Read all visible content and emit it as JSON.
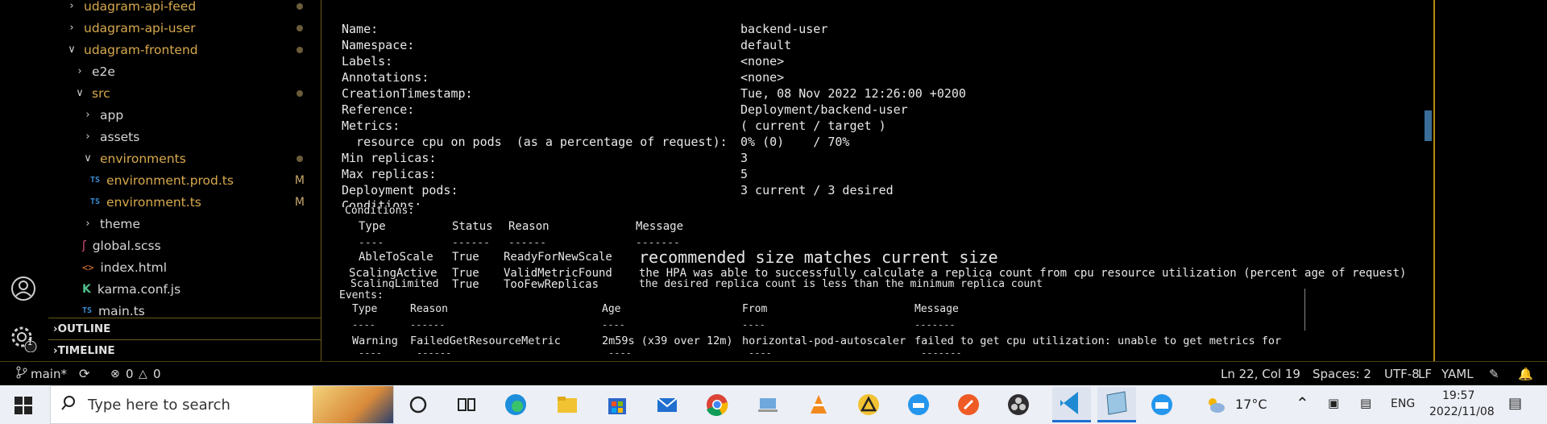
{
  "explorer": {
    "items": [
      {
        "label": "udagram-api-feed",
        "type": "folder-collapsed",
        "indent": 0,
        "dot": true,
        "color": "yellow"
      },
      {
        "label": "udagram-api-user",
        "type": "folder-collapsed",
        "indent": 0,
        "dot": true,
        "color": "yellow"
      },
      {
        "label": "udagram-frontend",
        "type": "folder-expanded",
        "indent": 0,
        "dot": true,
        "color": "yellow"
      },
      {
        "label": "e2e",
        "type": "folder-collapsed",
        "indent": 1,
        "dot": false,
        "color": "normal"
      },
      {
        "label": "src",
        "type": "folder-expanded",
        "indent": 1,
        "dot": true,
        "color": "yellow"
      },
      {
        "label": "app",
        "type": "folder-collapsed",
        "indent": 2,
        "dot": false,
        "color": "normal"
      },
      {
        "label": "assets",
        "type": "folder-collapsed",
        "indent": 2,
        "dot": false,
        "color": "normal"
      },
      {
        "label": "environments",
        "type": "folder-expanded",
        "indent": 2,
        "dot": true,
        "color": "yellow"
      },
      {
        "label": "environment.prod.ts",
        "type": "ts",
        "indent": 3,
        "badge": "M",
        "color": "yellow"
      },
      {
        "label": "environment.ts",
        "type": "ts",
        "indent": 3,
        "badge": "M",
        "color": "yellow"
      },
      {
        "label": "theme",
        "type": "folder-collapsed",
        "indent": 2,
        "dot": false,
        "color": "normal"
      },
      {
        "label": "global.scss",
        "type": "scss",
        "indent": 2,
        "color": "normal"
      },
      {
        "label": "index.html",
        "type": "html",
        "indent": 2,
        "color": "normal"
      },
      {
        "label": "karma.conf.js",
        "type": "karma",
        "indent": 2,
        "color": "normal"
      },
      {
        "label": "main.ts",
        "type": "ts",
        "indent": 2,
        "color": "normal"
      }
    ],
    "outline_label": "OUTLINE",
    "timeline_label": "TIMELINE"
  },
  "terminal": {
    "fields": [
      {
        "key": "Name:",
        "value": "backend-user"
      },
      {
        "key": "Namespace:",
        "value": "default"
      },
      {
        "key": "Labels:",
        "value": "<none>"
      },
      {
        "key": "Annotations:",
        "value": "<none>"
      },
      {
        "key": "CreationTimestamp:",
        "value": "Tue, 08 Nov 2022 12:26:00 +0200"
      },
      {
        "key": "Reference:",
        "value": "Deployment/backend-user"
      },
      {
        "key": "Metrics:",
        "value": "( current / target )"
      },
      {
        "key": "  resource cpu on pods  (as a percentage of request):",
        "value": "0% (0)    / 70%"
      },
      {
        "key": "Min replicas:",
        "value": "3"
      },
      {
        "key": "Max replicas:",
        "value": "5"
      },
      {
        "key": "Deployment pods:",
        "value": "3 current / 3 desired"
      }
    ],
    "conditions_label": "Conditions:",
    "conditions_header": {
      "type": "Type",
      "status": "Status",
      "reason": "Reason",
      "message": "Message"
    },
    "conditions_dashes": {
      "type": "----",
      "status": "------",
      "reason": "------",
      "message": "-------"
    },
    "conditions": [
      {
        "type": "AbleToScale",
        "status": "True",
        "reason": "ReadyForNewScale",
        "message": "recommended size matches current size"
      },
      {
        "type": "ScalingActive",
        "status": "True",
        "reason": "ValidMetricFound",
        "message": "the HPA was able to successfully calculate a replica count from cpu resource utilization (percent age of request)"
      },
      {
        "type": "ScalingLimited",
        "status": "True",
        "reason": "TooFewReplicas",
        "message": "the desired replica count is less than the minimum replica count"
      }
    ],
    "events_label": "Events:",
    "events_header": {
      "type": "Type",
      "reason": "Reason",
      "age": "Age",
      "from": "From",
      "message": "Message"
    },
    "events_dashes": {
      "type": "----",
      "reason": "------",
      "age": "----",
      "from": "----",
      "message": "-------"
    },
    "events": [
      {
        "type": "Warning",
        "reason": "FailedGetResourceMetric",
        "age": "2m59s (x39 over 12m)",
        "from": "horizontal-pod-autoscaler",
        "message": "failed to get cpu utilization: unable to get metrics for"
      }
    ],
    "events_dashes2": {
      "type": "----",
      "reason": "------",
      "age": "----",
      "from": "----",
      "message": "-------"
    }
  },
  "statusbar": {
    "branch": "main*",
    "errors": "0",
    "warnings": "0",
    "position": "Ln 22, Col 19",
    "spaces": "Spaces: 2",
    "encoding": "UTF-8",
    "eol": "LF",
    "language": "YAML",
    "accounts_badge": "1"
  },
  "taskbar": {
    "search_placeholder": "Type here to search",
    "temperature": "17°C",
    "language": "ENG",
    "time": "19:57",
    "date": "2022/11/08"
  },
  "colors": {
    "accent_yellow": "#d7a94d",
    "ts_blue": "#3b8ed6",
    "vscode_blue": "#1f8ad2",
    "divider": "#b58a10"
  }
}
